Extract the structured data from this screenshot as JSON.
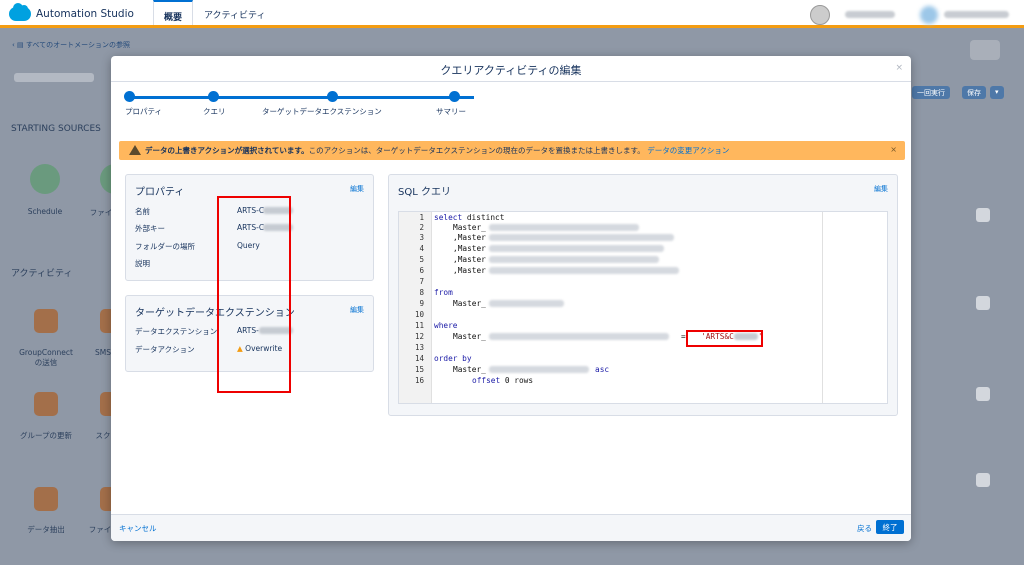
{
  "app": {
    "title": "Automation Studio",
    "tabs": [
      "概要",
      "アクティビティ"
    ],
    "back_link": "すべてのオートメーションの参照",
    "right_buttons": [
      "一回実行",
      "保存"
    ]
  },
  "background": {
    "starting_sources": "STARTING SOURCES",
    "activities": "アクティビティ",
    "sources": [
      "Schedule",
      "ファイ"
    ],
    "activity_items": [
      "GroupConnect\nの送信",
      "SMS",
      "グループの更新",
      "スク",
      "データ抽出",
      "ファイ"
    ]
  },
  "modal": {
    "title": "クエリアクティビティの編集",
    "close": "×",
    "steps": [
      "プロパティ",
      "クエリ",
      "ターゲットデータエクステンション",
      "サマリー"
    ],
    "warning": {
      "bold": "データの上書きアクションが選択されています。",
      "text": "このアクションは、ターゲットデータエクステンションの現在のデータを置換または上書きします。",
      "link": "データの変更アクション",
      "close": "×"
    },
    "properties": {
      "title": "プロパティ",
      "edit": "編集",
      "fields": [
        {
          "label": "名前",
          "value": "ARTS-C"
        },
        {
          "label": "外部キー",
          "value": "ARTS-C"
        },
        {
          "label": "フォルダーの場所",
          "value": "Query"
        },
        {
          "label": "説明",
          "value": ""
        }
      ]
    },
    "target": {
      "title": "ターゲットデータエクステンション",
      "edit": "編集",
      "fields": [
        {
          "label": "データエクステンション",
          "value": "ARTS-"
        },
        {
          "label": "データアクション",
          "value": "Overwrite"
        }
      ]
    },
    "sql": {
      "title": "SQL クエリ",
      "edit": "編集",
      "line_numbers": [
        "1",
        "2",
        "3",
        "4",
        "5",
        "6",
        "7",
        "8",
        "9",
        "10",
        "11",
        "12",
        "13",
        "14",
        "15",
        "16"
      ],
      "lines": {
        "l1_kw": "select",
        "l1_rest": " distinct",
        "master": "Master_",
        "comma_master": ",Master",
        "from": "from",
        "where": "where",
        "eq": "= ",
        "literal_open": "'ARTS&C",
        "literal_close": "'",
        "order_by": "order by",
        "asc": "asc",
        "offset_kw": "offset",
        "offset_num": " 0 ",
        "rows": "rows"
      }
    },
    "footer": {
      "cancel": "キャンセル",
      "back": "戻る",
      "finish": "終了"
    }
  }
}
